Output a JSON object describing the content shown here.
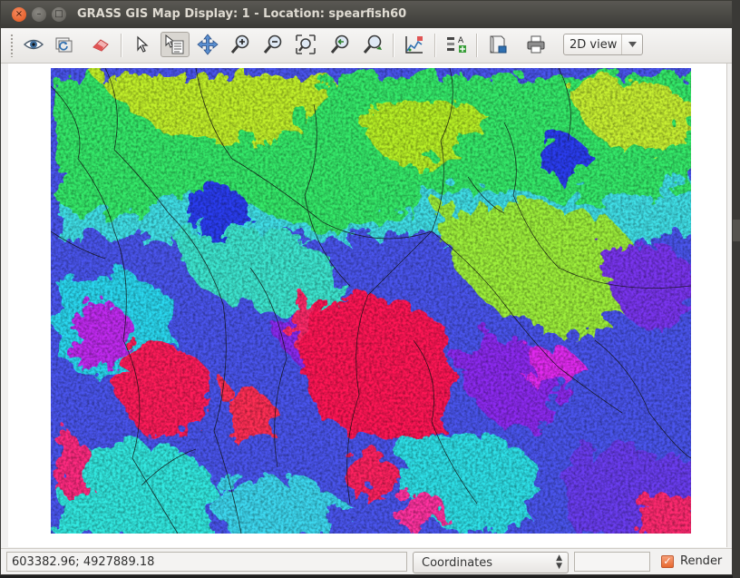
{
  "window": {
    "title": "GRASS GIS Map Display: 1  - Location: spearfish60",
    "buttons": {
      "close": "×",
      "minimize": "–",
      "maximize": "□"
    }
  },
  "toolbar": {
    "tools": [
      {
        "name": "display-map-icon"
      },
      {
        "name": "render-map-icon"
      },
      {
        "name": "erase-display-icon"
      },
      {
        "name": "pointer-icon"
      },
      {
        "name": "query-icon",
        "active": true
      },
      {
        "name": "pan-icon"
      },
      {
        "name": "zoom-in-icon"
      },
      {
        "name": "zoom-out-icon"
      },
      {
        "name": "zoom-extent-icon"
      },
      {
        "name": "zoom-back-icon"
      },
      {
        "name": "zoom-options-icon"
      },
      {
        "name": "analyze-icon"
      },
      {
        "name": "overlay-decorations-icon"
      },
      {
        "name": "save-map-icon"
      },
      {
        "name": "print-icon"
      }
    ],
    "view_mode": "2D view"
  },
  "statusbar": {
    "coordinates": "603382.96; 4927889.18",
    "mode": "Coordinates",
    "render_label": "Render",
    "render_checked": true
  },
  "desktop": {
    "percent": "100%"
  },
  "colors": {
    "magenta": "#ff1060",
    "purple": "#8a2cf0",
    "blue": "#3b3cf0",
    "cyan": "#18e3f0",
    "green": "#38f060",
    "yellowgreen": "#b8f028",
    "titlebar": "#3c3b37",
    "close": "#e0531a"
  }
}
